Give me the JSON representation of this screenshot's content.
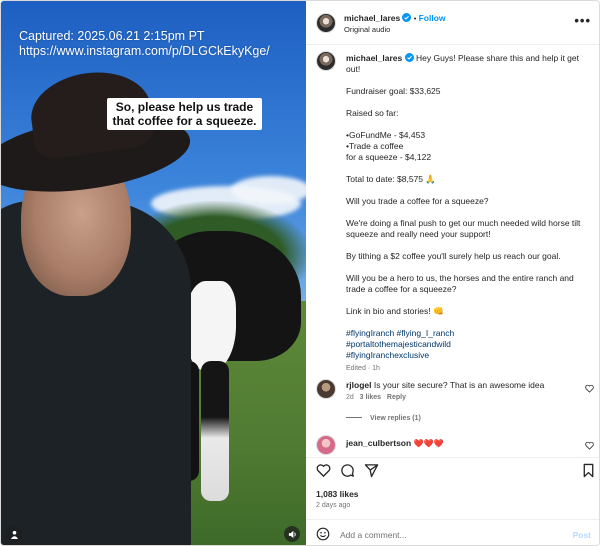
{
  "media": {
    "capture_line1": "Captured: 2025.06.21 2:15pm PT",
    "capture_line2": "https://www.instagram.com/p/DLGCkEkyKge/",
    "caption_overlay": "So, please help us trade that coffee for a squeeze."
  },
  "header": {
    "username": "michael_lares",
    "separator": "•",
    "follow_label": "Follow",
    "audio_label": "Original audio",
    "more_label": "•••"
  },
  "post": {
    "username": "michael_lares",
    "intro": "Hey Guys! Please share this and help it get out!",
    "goal": "Fundraiser goal: $33,625",
    "raised_label": "Raised so far:",
    "raised_1": "•GoFundMe - $4,453",
    "raised_2": "•Trade a coffee",
    "raised_3": "for a squeeze - $4,122",
    "total": "Total to date: $8,575 🙏",
    "q1": "Will you trade a coffee for a squeeze?",
    "p1": "We're doing a final push to get our much needed wild horse tilt squeeze and really need your support!",
    "p2": "By tithing a $2 coffee you'll surely help us reach our goal.",
    "p3": "Will you be a hero to us, the horses and the entire ranch and trade a coffee for a squeeze?",
    "link": "Link in bio and stories! 👊",
    "tags_1": "#flyingIranch #flying_I_ranch",
    "tags_2": "#portaltothemajesticandwild",
    "tags_3": "#flyingIranchexclusive",
    "edited": "Edited · 1h"
  },
  "comments": [
    {
      "username": "rjlogel",
      "text": "Is your site secure? That is an awesome idea",
      "age": "2d",
      "likes": "3 likes",
      "reply": "Reply",
      "view_replies": "View replies (1)"
    },
    {
      "username": "jean_culbertson",
      "text": "❤️❤️❤️"
    }
  ],
  "footer": {
    "likes": "1,083 likes",
    "ago": "2 days ago",
    "add_placeholder": "Add a comment...",
    "post_label": "Post"
  },
  "colors": {
    "accent": "#0095f6",
    "verified": "#0095f6",
    "hashtag": "#00376b",
    "muted": "#737373"
  }
}
